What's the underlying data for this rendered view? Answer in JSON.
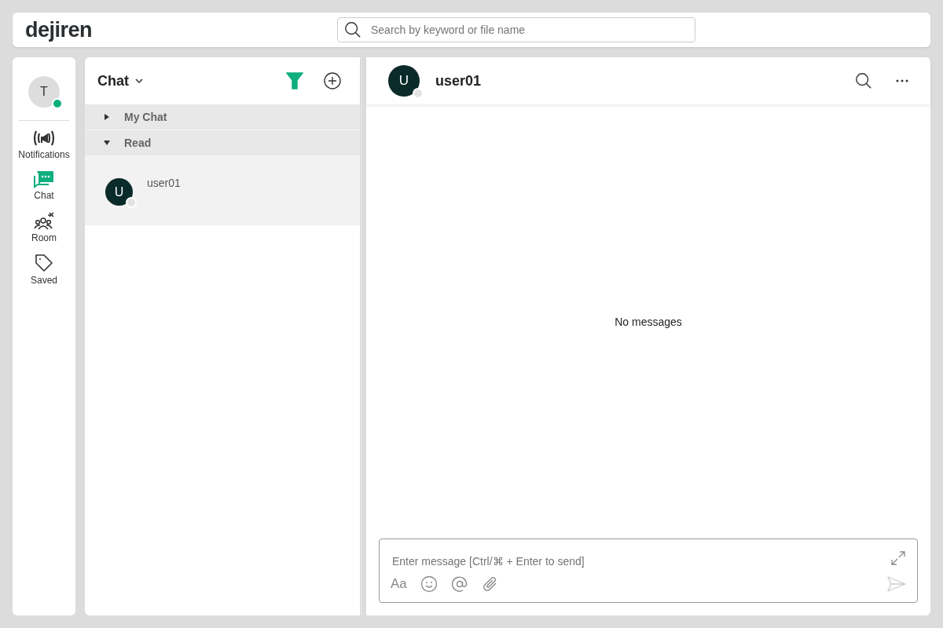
{
  "header": {
    "logo": "dejiren",
    "search": {
      "placeholder": "Search by keyword or file name"
    }
  },
  "profile": {
    "initial": "T",
    "online": true
  },
  "nav": [
    {
      "kind": "notifications",
      "label": "Notifications",
      "selected": false
    },
    {
      "kind": "chat",
      "label": "Chat",
      "selected": true
    },
    {
      "kind": "room",
      "label": "Room",
      "selected": false
    },
    {
      "kind": "saved",
      "label": "Saved",
      "selected": false
    }
  ],
  "list": {
    "title": "Chat",
    "filter_on": true,
    "groups": [
      {
        "label": "My Chat",
        "expanded": false
      },
      {
        "label": "Read",
        "expanded": true,
        "children": [
          {
            "initial": "U",
            "name": "user01",
            "online": false,
            "selected": true
          }
        ]
      }
    ]
  },
  "conversation": {
    "initial": "U",
    "name": "user01",
    "online": false,
    "empty_text": "No messages",
    "composer": {
      "placeholder": "Enter message [Ctrl/⌘ + Enter to send]",
      "format_label": "Aa"
    }
  }
}
